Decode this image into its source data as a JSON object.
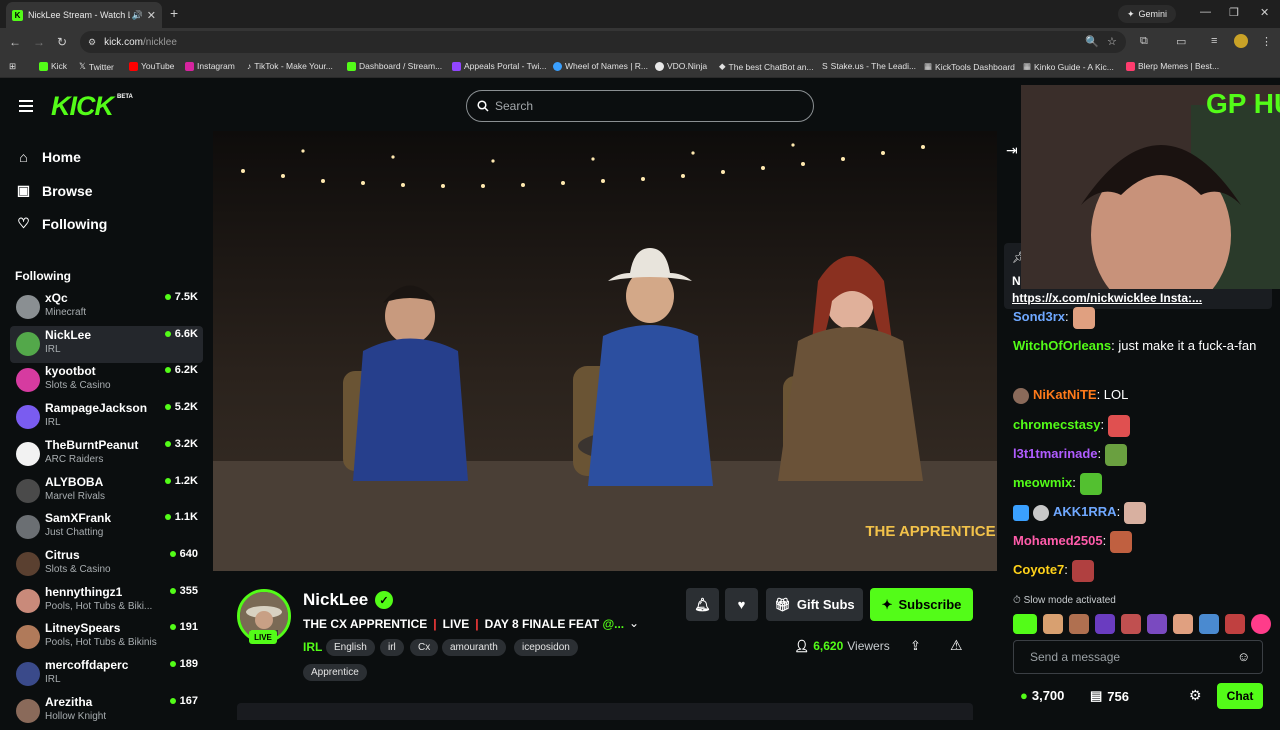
{
  "browser": {
    "tab_title": "NickLee Stream - Watch Li",
    "gemini_label": "Gemini",
    "url_host": "kick.com",
    "url_path": "/nicklee",
    "bookmarks": [
      "Kick",
      "Twitter",
      "YouTube",
      "Instagram",
      "TikTok - Make Your...",
      "Dashboard / Stream...",
      "Appeals Portal - Twi...",
      "Wheel of Names | R...",
      "VDO.Ninja",
      "The best ChatBot an...",
      "Stake.us - The Leadi...",
      "KickTools Dashboard",
      "Kinko Guide - A Kic...",
      "Blerp Memes | Best..."
    ]
  },
  "header": {
    "logo": "KICK",
    "beta": "BETA",
    "search_placeholder": "Search"
  },
  "nav": {
    "home": "Home",
    "browse": "Browse",
    "following": "Following"
  },
  "following": {
    "heading": "Following",
    "items": [
      {
        "name": "xQc",
        "category": "Minecraft",
        "viewers": "7.5K",
        "color": "#8a8f92"
      },
      {
        "name": "NickLee",
        "category": "IRL",
        "viewers": "6.6K",
        "color": "#53a84a"
      },
      {
        "name": "kyootbot",
        "category": "Slots & Casino",
        "viewers": "6.2K",
        "color": "#d63ba0"
      },
      {
        "name": "RampageJackson",
        "category": "IRL",
        "viewers": "5.2K",
        "color": "#7a5cf0"
      },
      {
        "name": "TheBurntPeanut",
        "category": "ARC Raiders",
        "viewers": "3.2K",
        "color": "#f2f2f2"
      },
      {
        "name": "ALYBOBA",
        "category": "Marvel Rivals",
        "viewers": "1.2K",
        "color": "#4a4a4a"
      },
      {
        "name": "SamXFrank",
        "category": "Just Chatting",
        "viewers": "1.1K",
        "color": "#6b6f73"
      },
      {
        "name": "Citrus",
        "category": "Slots & Casino",
        "viewers": "640",
        "color": "#5a4030"
      },
      {
        "name": "hennythingz1",
        "category": "Pools, Hot Tubs & Biki...",
        "viewers": "355",
        "color": "#c98a7a"
      },
      {
        "name": "LitneySpears",
        "category": "Pools, Hot Tubs & Bikinis",
        "viewers": "191",
        "color": "#b07a5a"
      },
      {
        "name": "mercoffdaperc",
        "category": "IRL",
        "viewers": "189",
        "color": "#3a4a8a"
      },
      {
        "name": "Arezitha",
        "category": "Hollow Knight",
        "viewers": "167",
        "color": "#8a6a5a"
      }
    ]
  },
  "stream": {
    "streamer": "NickLee",
    "live_badge": "LIVE",
    "title_parts": [
      "THE CX APPRENTICE",
      "LIVE",
      "DAY 8 FINALE FEAT "
    ],
    "title_mention": "@...",
    "category": "IRL",
    "tags": [
      "English",
      "irl",
      "Cx",
      "amouranth",
      "iceposidon",
      "Apprentice"
    ],
    "gift_subs": "Gift Subs",
    "subscribe": "Subscribe",
    "viewers_count": "6,620",
    "viewers_label": "Viewers",
    "overlay_brand": "THE APPRENTICE CX"
  },
  "webcam": {
    "overlay_text": "GP HUSTLA"
  },
  "chat": {
    "pinned_initial": "N",
    "pinned_link": "https://x.com/nickwicklee Insta:...",
    "messages": [
      {
        "user": "Sond3rx",
        "color": "#6fa8ff",
        "text": "",
        "emote": "#e0a080"
      },
      {
        "user": "WitchOfOrleans",
        "color": "#53fc18",
        "text": " just make it a fuck-a-fan",
        "emote": ""
      },
      {
        "user": "NiKatNiTE",
        "color": "#ff7a1a",
        "text": " LOL",
        "emote": ""
      },
      {
        "user": "chromecstasy",
        "color": "#53fc18",
        "text": "",
        "emote": "#e05050"
      },
      {
        "user": "l3t1tmarinade",
        "color": "#b05cff",
        "text": "",
        "emote": "#6aa040"
      },
      {
        "user": "meowmix",
        "color": "#53fc18",
        "text": "",
        "emote": "#53c030"
      },
      {
        "user": "AKK1RRA",
        "color": "#6fa8ff",
        "text": "",
        "emote": "#d8b0a0"
      },
      {
        "user": "Mohamed2505",
        "color": "#ff5caa",
        "text": "",
        "emote": "#c06040"
      },
      {
        "user": "Coyote7",
        "color": "#ffd21a",
        "text": "",
        "emote": "#b04040"
      }
    ],
    "slow_mode": "Slow mode activated",
    "input_placeholder": "Send a message",
    "points": "3,700",
    "store_count": "756",
    "chat_button": "Chat"
  }
}
